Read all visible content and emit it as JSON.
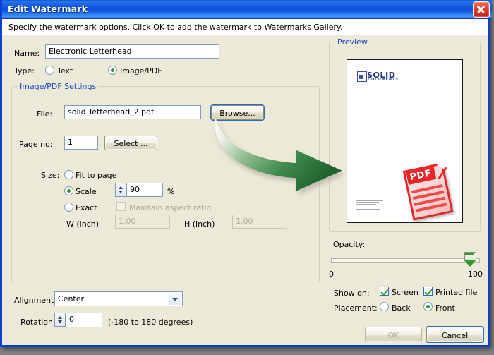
{
  "window": {
    "title": "Edit Watermark",
    "close_label": "Close",
    "instruction": "Specify the watermark options. Click OK to add the watermark to Watermarks Gallery."
  },
  "form": {
    "name_label": "Name:",
    "name_value": "Electronic Letterhead",
    "type_label": "Type:",
    "type_text_label": "Text",
    "type_image_label": "Image/PDF",
    "type_selected": "Image/PDF"
  },
  "settings": {
    "legend": "Image/PDF Settings",
    "file_label": "File:",
    "file_value": "solid_letterhead_2.pdf",
    "browse_label": "Browse...",
    "page_label": "Page no:",
    "page_value": "1",
    "select_label": "Select ...",
    "size_label": "Size:",
    "fit_label": "Fit to page",
    "scale_label": "Scale",
    "scale_value": "90",
    "percent_label": "%",
    "exact_label": "Exact",
    "maintain_label": "Maintain aspect ratio",
    "width_label": "W (inch)",
    "width_value": "1.00",
    "height_label": "H (inch)",
    "height_value": "1.00",
    "size_selected": "Scale"
  },
  "alignment": {
    "label": "Alignment:",
    "value": "Center",
    "options": [
      "Center"
    ]
  },
  "rotation": {
    "label": "Rotation:",
    "value": "0",
    "hint": "(-180 to 180 degrees)"
  },
  "preview": {
    "legend": "Preview",
    "logo_primary": "SOLID",
    "logo_secondary": "DOCUMENTS",
    "pdf_badge": "PDF"
  },
  "opacity": {
    "label": "Opacity:",
    "min_label": "0",
    "max_label": "100",
    "value": 100
  },
  "showon": {
    "label": "Show on:",
    "screen_label": "Screen",
    "screen_checked": true,
    "printed_label": "Printed file",
    "printed_checked": true
  },
  "placement": {
    "label": "Placement:",
    "back_label": "Back",
    "front_label": "Front",
    "selected": "Front"
  },
  "footer": {
    "ok_label": "OK",
    "ok_enabled": false,
    "cancel_label": "Cancel"
  },
  "colors": {
    "title_blue": "#0e56d6",
    "dialog_face": "#ece9d8",
    "legend_blue": "#1c46c4",
    "accent_green": "#2d9b2d",
    "arrow_green": "#2f7a3e",
    "pdf_red": "#e8262a"
  }
}
